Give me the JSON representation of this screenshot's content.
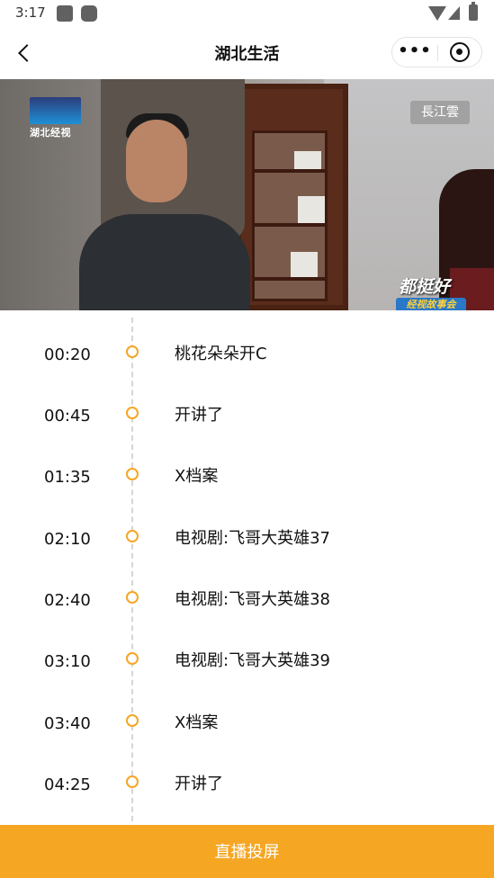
{
  "status_bar": {
    "time": "3:17",
    "icons": [
      "notification-icon",
      "notification-icon",
      "wifi-icon",
      "signal-icon",
      "battery-icon"
    ]
  },
  "nav": {
    "title": "湖北生活",
    "more_label": "•••",
    "icons": [
      "back-icon",
      "more-icon",
      "close-mini-program-icon"
    ]
  },
  "video": {
    "channel_logo": "湖北经视",
    "watermark": "長江雲",
    "show_name": "都挺好",
    "show_badge": "经视故事会"
  },
  "schedule": [
    {
      "time": "00:20",
      "title": "桃花朵朵开C"
    },
    {
      "time": "00:45",
      "title": "开讲了"
    },
    {
      "time": "01:35",
      "title": "X档案"
    },
    {
      "time": "02:10",
      "title": "电视剧:飞哥大英雄37"
    },
    {
      "time": "02:40",
      "title": "电视剧:飞哥大英雄38"
    },
    {
      "time": "03:10",
      "title": "电视剧:飞哥大英雄39"
    },
    {
      "time": "03:40",
      "title": "X档案"
    },
    {
      "time": "04:25",
      "title": "开讲了"
    }
  ],
  "cast_button": "直播投屏",
  "colors": {
    "accent": "#f5a623",
    "text": "#111111",
    "timeline": "#d6d6d6"
  }
}
